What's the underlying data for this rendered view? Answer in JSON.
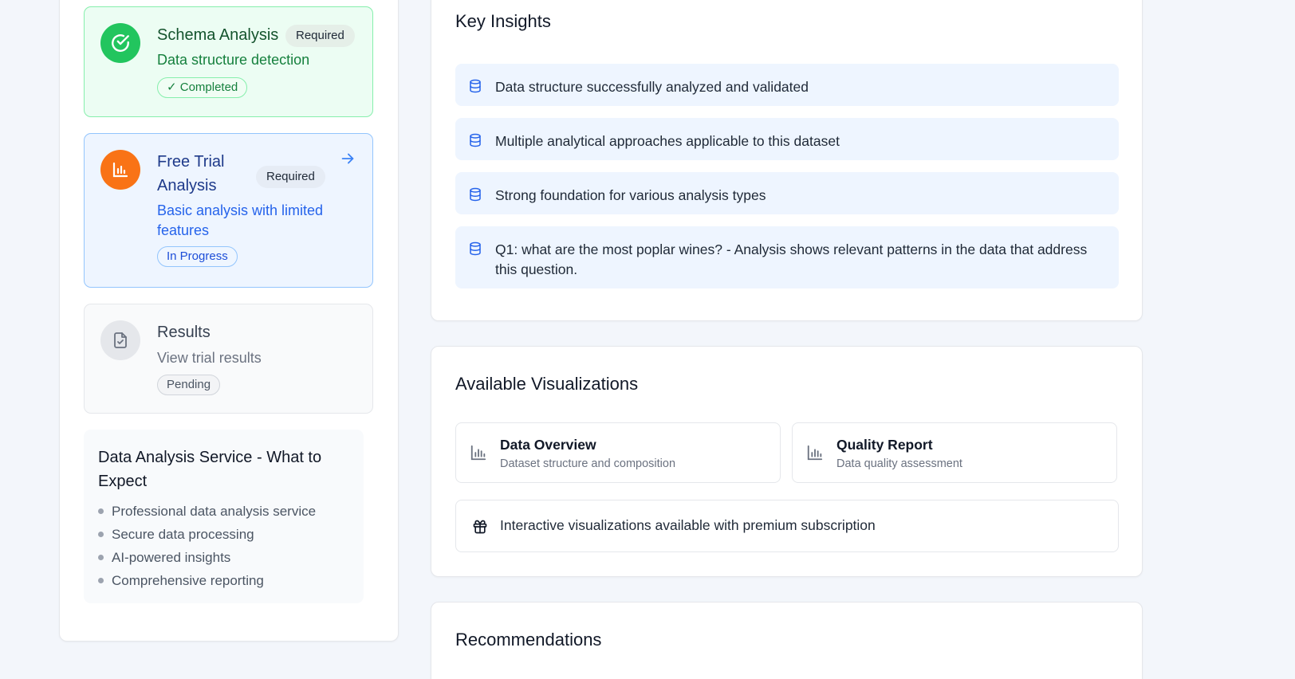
{
  "steps": [
    {
      "title": "Schema Analysis",
      "badge": "Required",
      "description": "Data structure detection",
      "status": "✓ Completed",
      "icon": "check-circle-icon"
    },
    {
      "title": "Free Trial Analysis",
      "badge": "Required",
      "description": "Basic analysis with limited features",
      "status": "In Progress",
      "icon": "bar-chart-icon"
    },
    {
      "title": "Results",
      "description": "View trial results",
      "status": "Pending",
      "icon": "file-check-icon"
    }
  ],
  "info": {
    "title": "Data Analysis Service - What to Expect",
    "items": [
      "Professional data analysis service",
      "Secure data processing",
      "AI-powered insights",
      "Comprehensive reporting"
    ]
  },
  "insights": {
    "title": "Key Insights",
    "items": [
      "Data structure successfully analyzed and validated",
      "Multiple analytical approaches applicable to this dataset",
      "Strong foundation for various analysis types",
      "Q1: what are the most poplar wines? - Analysis shows relevant patterns in the data that address this question."
    ]
  },
  "visualizations": {
    "title": "Available Visualizations",
    "tiles": [
      {
        "title": "Data Overview",
        "subtitle": "Dataset structure and composition"
      },
      {
        "title": "Quality Report",
        "subtitle": "Data quality assessment"
      }
    ],
    "premium_note": "Interactive visualizations available with premium subscription"
  },
  "recommendations": {
    "title": "Recommendations"
  },
  "colors": {
    "success": "#22c55e",
    "active": "#2563eb",
    "warning": "#f97316",
    "insight_bg": "#eef5ff"
  }
}
